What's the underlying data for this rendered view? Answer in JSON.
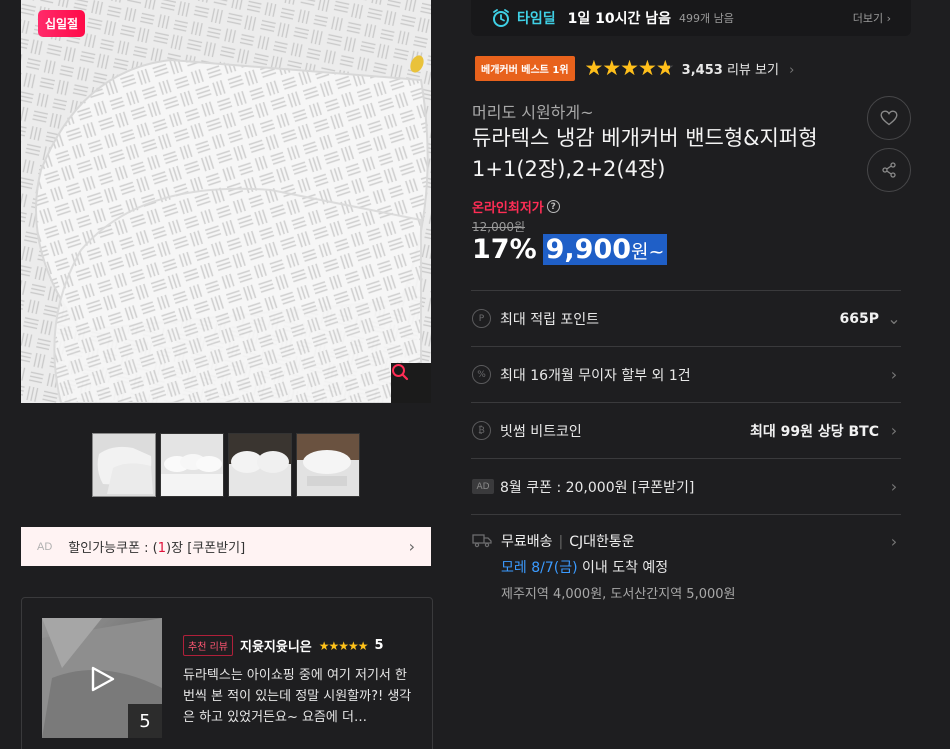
{
  "gallery": {
    "badge": "십일절",
    "thumbnail_count": 4
  },
  "coupon_bar": {
    "ad": "AD",
    "prefix": "할인가능쿠폰 : (",
    "count": "1",
    "suffix": ")장 [쿠폰받기]"
  },
  "review_card": {
    "media_count": "5",
    "tag": "추천 리뷰",
    "reviewer": "지윳지윳니은",
    "stars": "★★★★★",
    "score": "5",
    "body": "듀라텍스는 아이쇼핑 중에 여기 저기서 한번씩 본 적이 있는데 정말 시원할까?! 생각은 하고 있었거든요~ 요즘에 더…"
  },
  "timedeal": {
    "label": "타임딜",
    "remaining_time": "1일 10시간 남음",
    "remaining_count": "499개 남음",
    "more": "더보기"
  },
  "product": {
    "rank_badge": "베개커버 베스트 1위",
    "rating": 4.8,
    "rating_max": 5,
    "review_count": "3,453",
    "review_label": "리뷰 보기",
    "subtitle": "머리도 시원하게~",
    "title": "듀라텍스 냉감 베개커버 밴드형&지퍼형 1+1(2장),2+2(4장)",
    "lowest_label": "온라인최저가",
    "original_price": "12,000원",
    "discount": "17%",
    "price": "9,900",
    "price_unit": "원~"
  },
  "info": {
    "points_label": "최대 적립 포인트",
    "points_value": "665P",
    "installment_label": "최대 16개월 무이자 할부 외 1건",
    "bitcoin_label": "빗썸 비트코인",
    "bitcoin_value": "최대 99원 상당 BTC",
    "coupon_ad": "AD",
    "coupon_label": "8월 쿠폰 : 20,000원 [쿠폰받기]",
    "shipping_free": "무료배송",
    "shipping_carrier": "CJ대한통운",
    "arrival_date": "모레 8/7(금)",
    "arrival_suffix": " 이내 도착 예정",
    "shipping_extra": "제주지역 4,000원, 도서산간지역 5,000원"
  },
  "colors": {
    "accent_red": "#ff2d55",
    "timedeal_cyan": "#3fd0e5",
    "price_highlight": "#1f5fc7",
    "star": "#ffbf1a",
    "rank_badge": "#e8621c"
  }
}
